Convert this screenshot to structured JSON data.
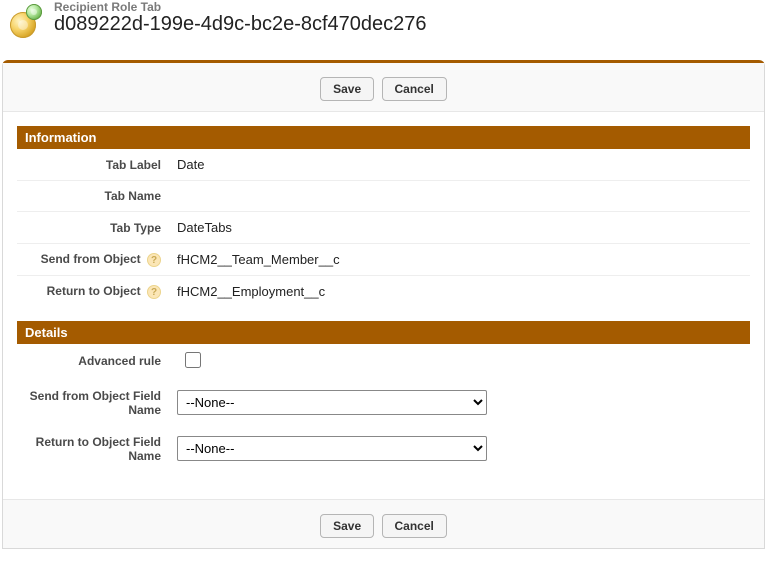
{
  "header": {
    "subtitle": "Recipient Role Tab",
    "title": "d089222d-199e-4d9c-bc2e-8cf470dec276"
  },
  "buttons": {
    "save": "Save",
    "cancel": "Cancel"
  },
  "sections": {
    "information": {
      "heading": "Information",
      "fields": {
        "tab_label": {
          "label": "Tab Label",
          "value": "Date"
        },
        "tab_name": {
          "label": "Tab Name",
          "value": ""
        },
        "tab_type": {
          "label": "Tab Type",
          "value": "DateTabs"
        },
        "send_from_object": {
          "label": "Send from Object",
          "value": "fHCM2__Team_Member__c"
        },
        "return_to_object": {
          "label": "Return to Object",
          "value": "fHCM2__Employment__c"
        }
      }
    },
    "details": {
      "heading": "Details",
      "fields": {
        "advanced_rule": {
          "label": "Advanced rule",
          "checked": false
        },
        "send_from_field": {
          "label": "Send from Object Field Name",
          "selected": "--None--",
          "options": [
            "--None--"
          ]
        },
        "return_to_field": {
          "label": "Return to Object Field Name",
          "selected": "--None--",
          "options": [
            "--None--"
          ]
        }
      }
    }
  },
  "icons": {
    "help_glyph": "?"
  }
}
